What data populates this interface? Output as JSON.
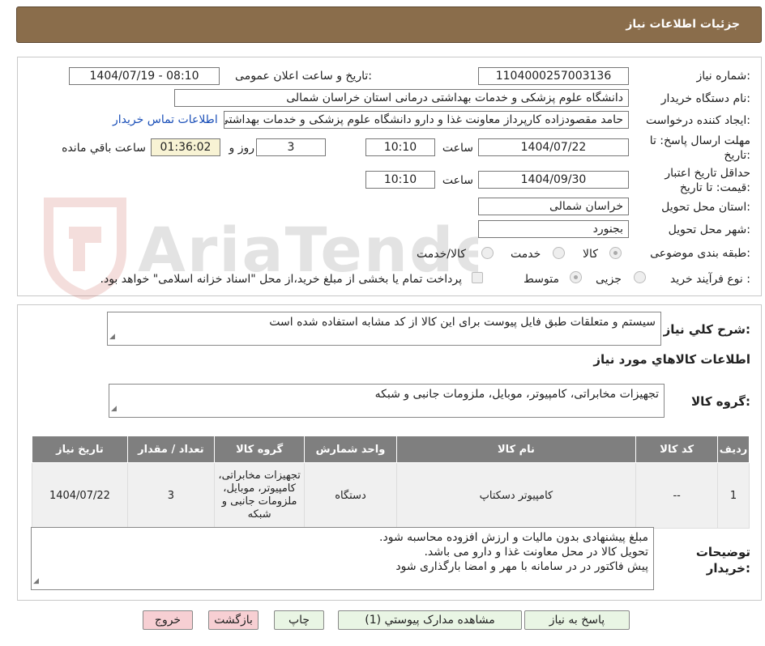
{
  "header": {
    "title": "جزئیات اطلاعات نیاز"
  },
  "info": {
    "need_number_label": "شماره نیاز:",
    "need_number": "1104000257003136",
    "announce_label": "تاریخ و ساعت اعلان عمومی:",
    "announce_value": "1404/07/19 - 08:10",
    "buyer_org_label": "نام دستگاه خریدار:",
    "buyer_org": "دانشگاه علوم پزشکی و خدمات بهداشتی درمانی استان خراسان شمالی",
    "requester_label": "ایجاد کننده درخواست:",
    "requester": "حامد مقصودزاده کارپرداز معاونت غذا و دارو دانشگاه علوم پزشکی و خدمات بهداشتی درمانی استان خراسان شمالی",
    "contact_link": "اطلاعات تماس خریدار",
    "reply_deadline_label": "مهلت ارسال پاسخ: تا تاریخ:",
    "reply_date": "1404/07/22",
    "time_label": "ساعت",
    "reply_time": "10:10",
    "days": "3",
    "days_label": "روز و",
    "remaining": "01:36:02",
    "remaining_label": "ساعت باقي مانده",
    "price_valid_label": "حداقل تاریخ اعتبار قیمت: تا تاریخ:",
    "price_date": "1404/09/30",
    "price_time": "10:10",
    "province_label": "استان محل تحویل:",
    "province": "خراسان شمالی",
    "city_label": "شهر محل تحویل:",
    "city": "بجنورد",
    "category_label": "طبقه بندی موضوعی:",
    "cat_goods": "کالا",
    "cat_service": "خدمت",
    "cat_both": "کالا/خدمت",
    "process_label": "نوع فرآیند خرید :",
    "proc_partial": "جزیی",
    "proc_medium": "متوسط",
    "payment_note": "پرداخت تمام یا بخشی از مبلغ خرید،از محل \"اسناد خزانه اسلامی\" خواهد بود."
  },
  "watermark": {
    "text": "AriaTender.neT"
  },
  "details": {
    "summary_label": "شرح کلي نياز:",
    "summary": "سیستم و متعلقات طبق فایل پیوست برای این کالا از کد مشابه استفاده شده است",
    "goods_info_title": "اطلاعات کالاهاي مورد نياز",
    "goods_group_label": "گروه کالا:",
    "goods_group": "تجهیزات مخابراتی، کامپیوتر، موبایل، ملزومات جانبی و شبکه"
  },
  "table": {
    "headers": [
      "ردیف",
      "کد کالا",
      "نام کالا",
      "واحد شمارش",
      "گروه کالا",
      "تعداد / مقدار",
      "تاریخ نیاز"
    ],
    "rows": [
      [
        "1",
        "--",
        "کامپیوتر دسکتاپ",
        "دستگاه",
        "تجهیزات مخابراتی، کامپیوتر، موبایل، ملزومات جانبی و شبکه",
        "3",
        "1404/07/22"
      ]
    ]
  },
  "buyer_notes": {
    "label": "توضیحات خریدار:",
    "lines": [
      "مبلغ پیشنهادی بدون مالیات و ارزش افزوده محاسبه شود.",
      "تحویل کالا در محل معاونت غذا و دارو می باشد.",
      "پیش فاکتور در در سامانه با مهر و امضا بارگذاری شود"
    ]
  },
  "buttons": {
    "reply": "پاسخ به نیاز",
    "attachments": "مشاهده مدارک پیوستي (1)",
    "print": "چاپ",
    "back": "بازگشت",
    "exit": "خروج"
  }
}
